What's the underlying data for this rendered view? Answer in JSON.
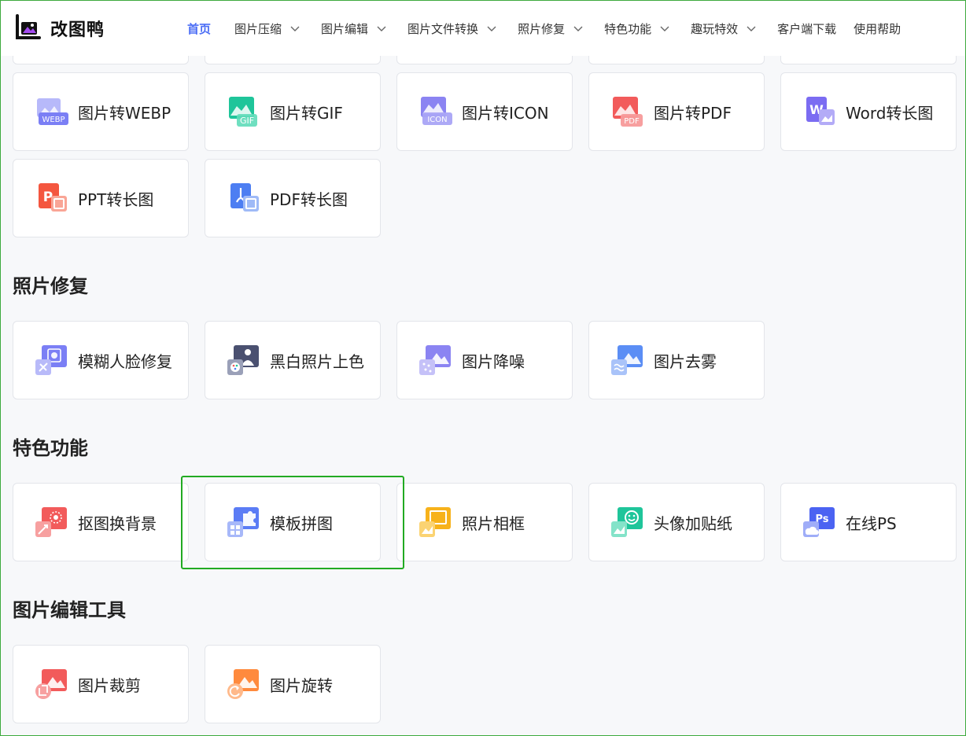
{
  "brand": {
    "name": "改图鸭",
    "icon": "logo-icon"
  },
  "nav": [
    {
      "label": "首页",
      "active": true,
      "dropdown": false
    },
    {
      "label": "图片压缩",
      "dropdown": true
    },
    {
      "label": "图片编辑",
      "dropdown": true
    },
    {
      "label": "图片文件转换",
      "dropdown": true
    },
    {
      "label": "照片修复",
      "dropdown": true
    },
    {
      "label": "特色功能",
      "dropdown": true
    },
    {
      "label": "趣玩特效",
      "dropdown": true
    },
    {
      "label": "客户端下载",
      "dropdown": false
    },
    {
      "label": "使用帮助",
      "dropdown": false
    }
  ],
  "convert": {
    "cards": [
      {
        "label": "图片转WEBP",
        "icon": "webp-icon",
        "badge": "WEBP",
        "color": "#7b7ff5"
      },
      {
        "label": "图片转GIF",
        "icon": "gif-icon",
        "badge": "GIF",
        "color": "#1fc59a"
      },
      {
        "label": "图片转ICON",
        "icon": "icon-format-icon",
        "badge": "ICON",
        "color": "#8b84f2"
      },
      {
        "label": "图片转PDF",
        "icon": "pdf-icon",
        "badge": "PDF",
        "color": "#f25b5b"
      },
      {
        "label": "Word转长图",
        "icon": "word-icon",
        "badge": "W",
        "color": "#7b6cf2"
      },
      {
        "label": "PPT转长图",
        "icon": "ppt-icon",
        "badge": "P",
        "color": "#f4563f"
      },
      {
        "label": "PDF转长图",
        "icon": "pdf-long-icon",
        "badge": "",
        "color": "#4d7ef2"
      }
    ]
  },
  "repair": {
    "title": "照片修复",
    "cards": [
      {
        "label": "模糊人脸修复",
        "icon": "face-repair-icon",
        "color": "#7b7ff5"
      },
      {
        "label": "黑白照片上色",
        "icon": "colorize-icon",
        "color": "#4a5070"
      },
      {
        "label": "图片降噪",
        "icon": "denoise-icon",
        "color": "#8b84f2"
      },
      {
        "label": "图片去雾",
        "icon": "dehaze-icon",
        "color": "#5b8ef5"
      }
    ]
  },
  "feature": {
    "title": "特色功能",
    "cards": [
      {
        "label": "抠图换背景",
        "icon": "cutout-icon",
        "color": "#f25b5b"
      },
      {
        "label": "模板拼图",
        "icon": "collage-icon",
        "color": "#5b7cf5"
      },
      {
        "label": "照片相框",
        "icon": "frame-icon",
        "color": "#f7b21b"
      },
      {
        "label": "头像加贴纸",
        "icon": "sticker-icon",
        "color": "#1fc59a"
      },
      {
        "label": "在线PS",
        "icon": "ps-icon",
        "badge": "Ps",
        "color": "#4b63f2"
      }
    ]
  },
  "edit": {
    "title": "图片编辑工具",
    "cards": [
      {
        "label": "图片裁剪",
        "icon": "crop-icon",
        "color": "#f25b5b"
      },
      {
        "label": "图片旋转",
        "icon": "rotate-icon",
        "color": "#ff8a3d"
      }
    ]
  }
}
